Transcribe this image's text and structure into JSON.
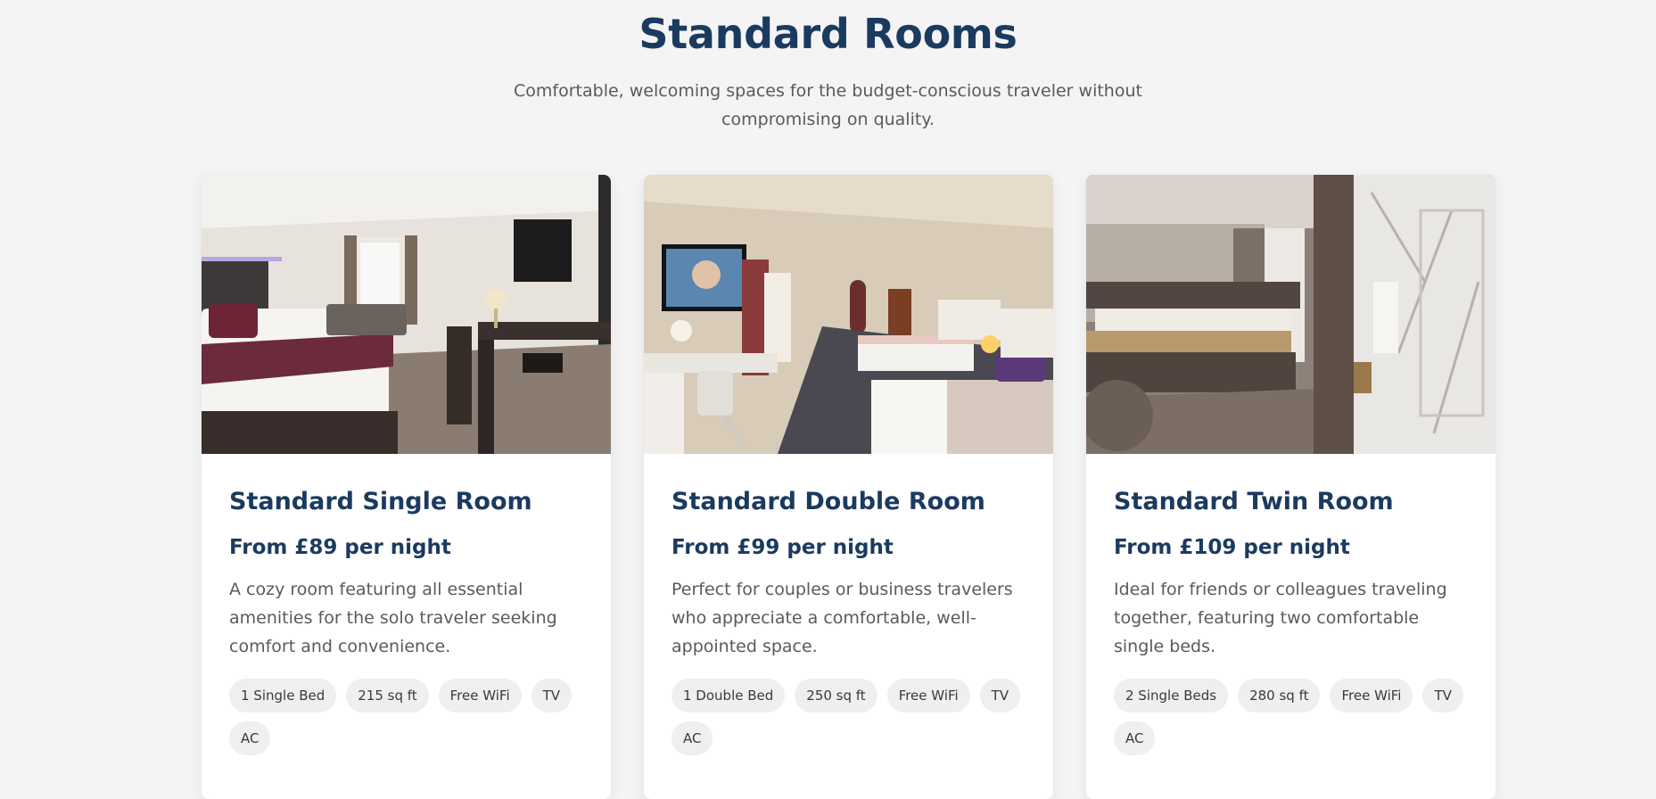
{
  "header": {
    "title": "Standard Rooms",
    "subtitle": "Comfortable, welcoming spaces for the budget-conscious traveler without compromising on quality."
  },
  "rooms": [
    {
      "name": "Standard Single Room",
      "price": "From £89 per night",
      "description": "A cozy room featuring all essential amenities for the solo traveler seeking comfort and convenience.",
      "image": "single-room-photo",
      "tags": [
        "1 Single Bed",
        "215 sq ft",
        "Free WiFi",
        "TV",
        "AC"
      ]
    },
    {
      "name": "Standard Double Room",
      "price": "From £99 per night",
      "description": "Perfect for couples or business travelers who appreciate a comfortable, well-appointed space.",
      "image": "double-room-photo",
      "tags": [
        "1 Double Bed",
        "250 sq ft",
        "Free WiFi",
        "TV",
        "AC"
      ]
    },
    {
      "name": "Standard Twin Room",
      "price": "From £109 per night",
      "description": "Ideal for friends or colleagues traveling together, featuring two comfortable single beds.",
      "image": "twin-room-photo",
      "tags": [
        "2 Single Beds",
        "280 sq ft",
        "Free WiFi",
        "TV",
        "AC"
      ]
    }
  ],
  "colors": {
    "heading": "#1b3a5f",
    "body_text": "#5a5a5a",
    "background": "#f4f4f4",
    "tag_background": "#efefef"
  }
}
